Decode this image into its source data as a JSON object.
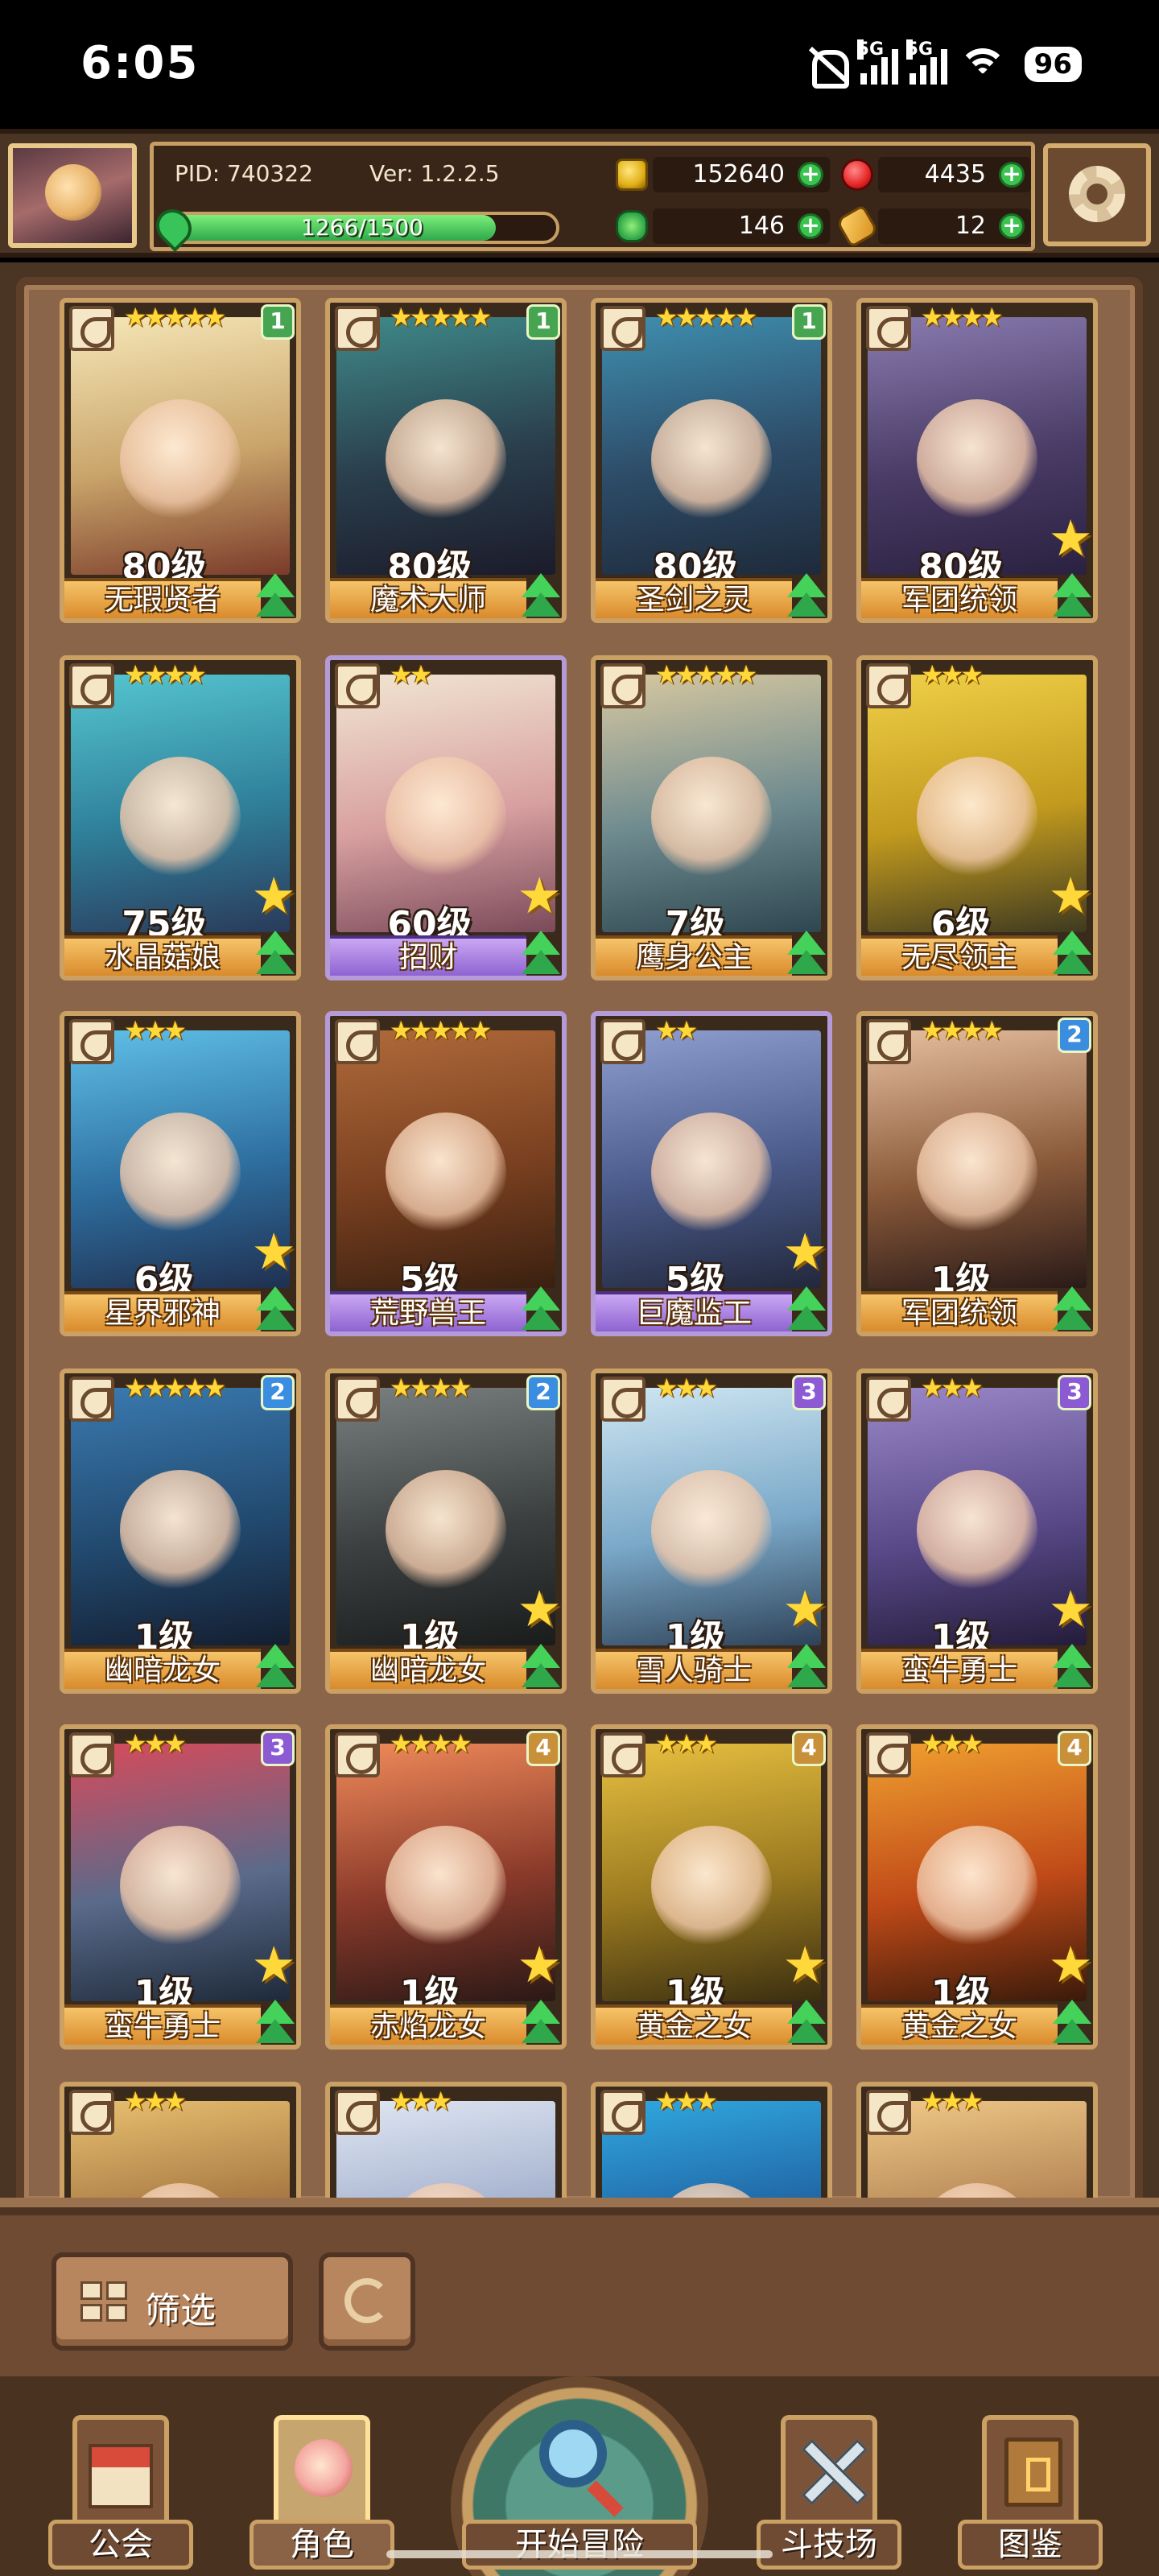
{
  "status_bar": {
    "time": "6:05",
    "net1": "5G",
    "net2": "5G",
    "battery": "96",
    "icons": [
      "mute-icon",
      "signal-icon",
      "signal-icon",
      "wifi-icon",
      "battery-icon"
    ]
  },
  "player": {
    "pid": "PID: 740322",
    "version": "Ver: 1.2.2.5",
    "xp_text": "1266/1500",
    "xp_fraction": 0.844,
    "coins": "152640",
    "rubies": "4435",
    "clovers": "146",
    "scrolls": "12"
  },
  "characters": [
    {
      "name": "无瑕贤者",
      "level": "80级",
      "stars": "★★★★★",
      "tier": "1",
      "frame": "gold",
      "fav": false,
      "bg": [
        "#f6e7b8",
        "#c9a46a",
        "#7a3b2a"
      ]
    },
    {
      "name": "魔术大师",
      "level": "80级",
      "stars": "★★★★★",
      "tier": "1",
      "frame": "gold",
      "fav": false,
      "bg": [
        "#3f8a8a",
        "#2a3e4c",
        "#1b1b2a"
      ]
    },
    {
      "name": "圣剑之灵",
      "level": "80级",
      "stars": "★★★★★",
      "tier": "1",
      "frame": "gold",
      "fav": false,
      "bg": [
        "#3f8fb0",
        "#2d4c68",
        "#1e2a3a"
      ]
    },
    {
      "name": "军团统领",
      "level": "80级",
      "stars": "★★★★",
      "tier": "",
      "frame": "gold",
      "fav": true,
      "bg": [
        "#8a7bb0",
        "#4a3c66",
        "#2a2140"
      ]
    },
    {
      "name": "水晶菇娘",
      "level": "75级",
      "stars": "★★★★",
      "tier": "",
      "frame": "gold",
      "fav": true,
      "bg": [
        "#55c6d0",
        "#2f7f9a",
        "#2a3a5a"
      ]
    },
    {
      "name": "招财",
      "level": "60级",
      "stars": "★★",
      "tier": "",
      "frame": "purple",
      "fav": true,
      "bg": [
        "#f1e6d2",
        "#d8a0a0",
        "#7a4a5a"
      ]
    },
    {
      "name": "鹰身公主",
      "level": "7级",
      "stars": "★★★★★",
      "tier": "",
      "frame": "gold",
      "fav": false,
      "bg": [
        "#d8c8a0",
        "#6d8a8f",
        "#2e4650"
      ]
    },
    {
      "name": "无尽领主",
      "level": "6级",
      "stars": "★★★",
      "tier": "",
      "frame": "gold",
      "fav": true,
      "bg": [
        "#f0d048",
        "#c29a1e",
        "#3e3a20"
      ]
    },
    {
      "name": "星界邪神",
      "level": "6级",
      "stars": "★★★",
      "tier": "",
      "frame": "gold",
      "fav": true,
      "bg": [
        "#5fc0e8",
        "#2e6fa0",
        "#203050"
      ]
    },
    {
      "name": "荒野兽王",
      "level": "5级",
      "stars": "★★★★★",
      "tier": "",
      "frame": "purple",
      "fav": false,
      "bg": [
        "#b06a3a",
        "#7a4020",
        "#3a2010"
      ]
    },
    {
      "name": "巨魔监工",
      "level": "5级",
      "stars": "★★",
      "tier": "",
      "frame": "purple",
      "fav": true,
      "bg": [
        "#8fa0d0",
        "#4a5a8a",
        "#22283c"
      ]
    },
    {
      "name": "军团统领",
      "level": "1级",
      "stars": "★★★★",
      "tier": "2",
      "frame": "gold",
      "fav": false,
      "bg": [
        "#e6c0a0",
        "#8a5a3a",
        "#2a1a18"
      ]
    },
    {
      "name": "幽暗龙女",
      "level": "1级",
      "stars": "★★★★★",
      "tier": "2",
      "frame": "gold",
      "fav": false,
      "bg": [
        "#3a7ab0",
        "#224a70",
        "#141e30"
      ]
    },
    {
      "name": "幽暗龙女",
      "level": "1级",
      "stars": "★★★★",
      "tier": "2",
      "frame": "gold",
      "fav": true,
      "bg": [
        "#7a8080",
        "#3c4040",
        "#1a1c1c"
      ]
    },
    {
      "name": "雪人骑士",
      "level": "1级",
      "stars": "★★★",
      "tier": "3",
      "frame": "gold",
      "fav": true,
      "bg": [
        "#cfe6f2",
        "#7aa8c8",
        "#2e4258"
      ]
    },
    {
      "name": "蛮牛勇士",
      "level": "1级",
      "stars": "★★★",
      "tier": "3",
      "frame": "gold",
      "fav": true,
      "bg": [
        "#9a88c8",
        "#5a4a8a",
        "#241c3a"
      ]
    },
    {
      "name": "蛮牛勇士",
      "level": "1级",
      "stars": "★★★",
      "tier": "3",
      "frame": "gold",
      "fav": true,
      "bg": [
        "#d84a5a",
        "#5a6a8a",
        "#1e2a3a"
      ]
    },
    {
      "name": "赤焰龙女",
      "level": "1级",
      "stars": "★★★★",
      "tier": "4",
      "frame": "gold",
      "fav": true,
      "bg": [
        "#f08a5a",
        "#8a3a2a",
        "#2a1816"
      ]
    },
    {
      "name": "黄金之女",
      "level": "1级",
      "stars": "★★★",
      "tier": "4",
      "frame": "gold",
      "fav": true,
      "bg": [
        "#e8c040",
        "#9a7a20",
        "#3a2e10"
      ]
    },
    {
      "name": "黄金之女",
      "level": "1级",
      "stars": "★★★",
      "tier": "4",
      "frame": "gold",
      "fav": true,
      "bg": [
        "#f0a030",
        "#c04a18",
        "#3a1a0a"
      ]
    },
    {
      "name": "",
      "level": "",
      "stars": "★★★",
      "tier": "",
      "frame": "gold",
      "fav": false,
      "bg": [
        "#e8c070",
        "#9a6a3a",
        "#3a2818"
      ]
    },
    {
      "name": "",
      "level": "",
      "stars": "★★★",
      "tier": "",
      "frame": "gold",
      "fav": false,
      "bg": [
        "#dfe6f2",
        "#9aa8c8",
        "#3a4258"
      ]
    },
    {
      "name": "",
      "level": "",
      "stars": "★★★",
      "tier": "",
      "frame": "gold",
      "fav": false,
      "bg": [
        "#30a8e0",
        "#1e5a9a",
        "#122a4a"
      ]
    },
    {
      "name": "",
      "level": "",
      "stars": "★★★",
      "tier": "",
      "frame": "gold",
      "fav": false,
      "bg": [
        "#f0c888",
        "#a8784a",
        "#3a281a"
      ]
    }
  ],
  "controls": {
    "filter_label": "筛选"
  },
  "nav": {
    "guild": "公会",
    "role": "角色",
    "adventure": "开始冒险",
    "arena": "斗技场",
    "codex": "图鉴"
  }
}
